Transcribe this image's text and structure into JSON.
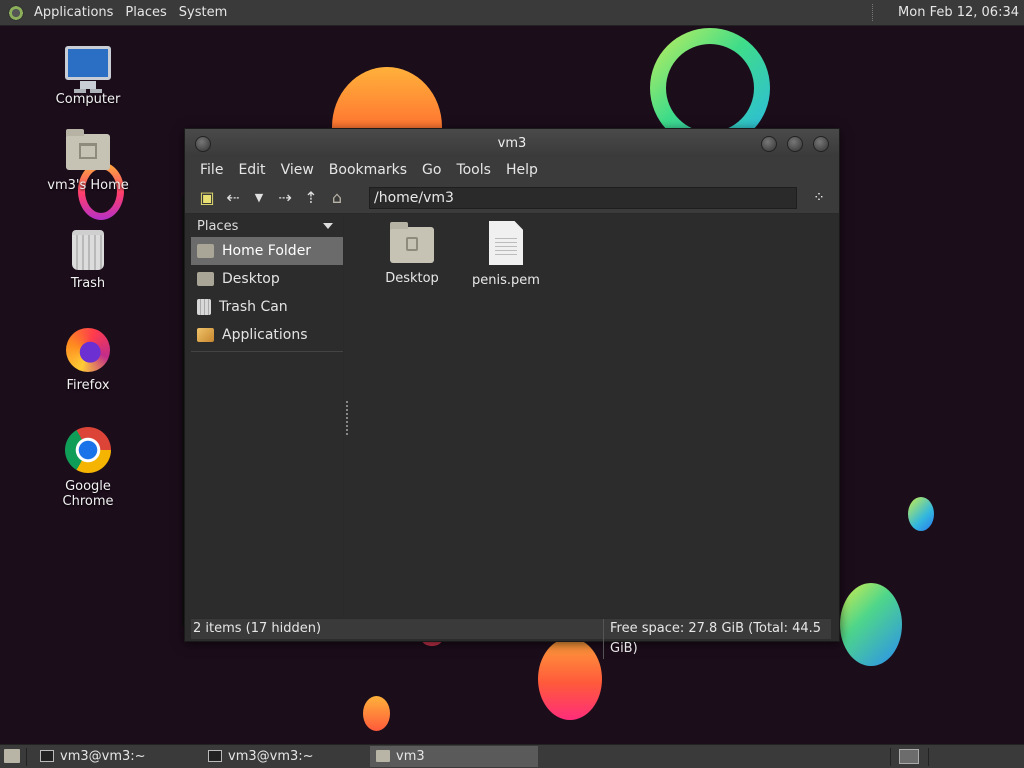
{
  "top_panel": {
    "menus": [
      "Applications",
      "Places",
      "System"
    ],
    "clock": "Mon Feb 12, 06:34"
  },
  "desktop_icons": [
    {
      "label": "Computer",
      "icon": "computer-icon"
    },
    {
      "label": "vm3's Home",
      "icon": "home-folder-icon"
    },
    {
      "label": "Trash",
      "icon": "trash-icon"
    },
    {
      "label": "Firefox",
      "icon": "firefox-icon"
    },
    {
      "label": "Google Chrome",
      "icon": "chrome-icon"
    }
  ],
  "window": {
    "title": "vm3",
    "menu": [
      "File",
      "Edit",
      "View",
      "Bookmarks",
      "Go",
      "Tools",
      "Help"
    ],
    "location": "/home/vm3",
    "sidebar": {
      "header": "Places",
      "items": [
        {
          "label": "Home Folder",
          "icon": "home-folder-icon",
          "active": true
        },
        {
          "label": "Desktop",
          "icon": "desktop-folder-icon",
          "active": false
        },
        {
          "label": "Trash Can",
          "icon": "trash-icon",
          "active": false
        },
        {
          "label": "Applications",
          "icon": "applications-icon",
          "active": false
        }
      ]
    },
    "files": [
      {
        "name": "Desktop",
        "type": "folder"
      },
      {
        "name": "penis.pem",
        "type": "file"
      }
    ],
    "status_left": "2 items (17 hidden)",
    "status_right": "Free space: 27.8 GiB (Total: 44.5 GiB)"
  },
  "taskbar": {
    "tasks": [
      {
        "label": "vm3@vm3:~",
        "icon": "terminal-icon",
        "active": false
      },
      {
        "label": "vm3@vm3:~",
        "icon": "terminal-icon",
        "active": false
      },
      {
        "label": "vm3",
        "icon": "folder-icon",
        "active": true
      }
    ]
  },
  "colors": {
    "desktop_bg": "#1c0d1b",
    "panel_bg": "#3a3a3a",
    "window_bg": "#2c2c2c",
    "selection": "#6b6b6b"
  }
}
